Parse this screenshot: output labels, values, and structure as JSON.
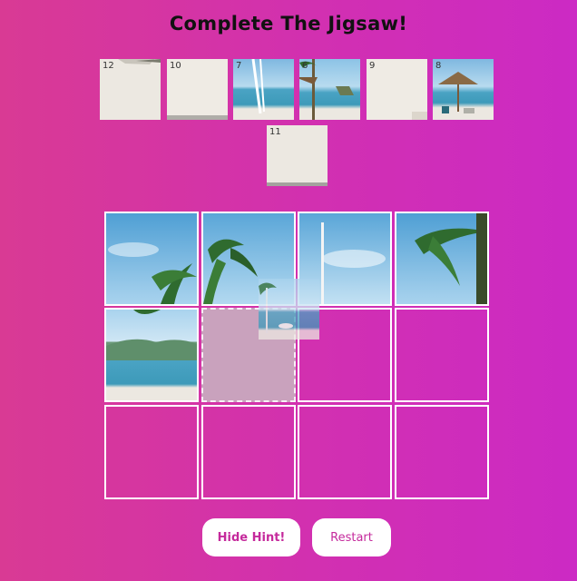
{
  "title": "Complete The Jigsaw!",
  "tray": {
    "pieces": [
      {
        "number": "12",
        "scene": "sand"
      },
      {
        "number": "10",
        "scene": "sand"
      },
      {
        "number": "7",
        "scene": "beach-swing"
      },
      {
        "number": "6",
        "scene": "beach-hut-palm"
      },
      {
        "number": "9",
        "scene": "sand"
      },
      {
        "number": "8",
        "scene": "beach-umbrella"
      },
      {
        "number": "11",
        "scene": "sand"
      }
    ]
  },
  "board": {
    "rows": 3,
    "cols": 4,
    "placed": [
      "palm-sky-1",
      "palm-sky-2",
      "sky-pole",
      "palm-sky-3",
      "mountains-sea",
      "hint",
      "",
      "",
      "",
      "",
      "",
      ""
    ]
  },
  "dragging_piece": {
    "scene": "sea-pole"
  },
  "buttons": {
    "hint_label": "Hide Hint!",
    "restart_label": "Restart"
  },
  "colors": {
    "background_start": "#d93a94",
    "background_end": "#cc2ac4",
    "button_text": "#c52a9c",
    "cell_border": "#ffffff"
  }
}
